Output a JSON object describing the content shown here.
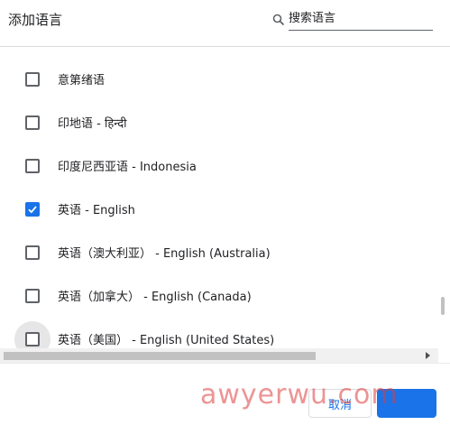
{
  "dialog": {
    "title": "添加语言",
    "search": {
      "placeholder": "搜索语言",
      "value": ""
    }
  },
  "languages": [
    {
      "label": "意第绪语",
      "checked": false
    },
    {
      "label": "印地语 - हिन्दी",
      "checked": false
    },
    {
      "label": "印度尼西亚语 - Indonesia",
      "checked": false
    },
    {
      "label": "英语 - English",
      "checked": true
    },
    {
      "label": "英语（澳大利亚） - English (Australia)",
      "checked": false
    },
    {
      "label": "英语（加拿大） - English (Canada)",
      "checked": false
    },
    {
      "label": "英语（美国） - English (United States)",
      "checked": false
    }
  ],
  "footer": {
    "cancel_label": "取消",
    "add_label": ""
  },
  "watermark": "awyerwu.com",
  "colors": {
    "accent": "#1a73e8",
    "text": "#202124",
    "border": "#dadce0"
  }
}
